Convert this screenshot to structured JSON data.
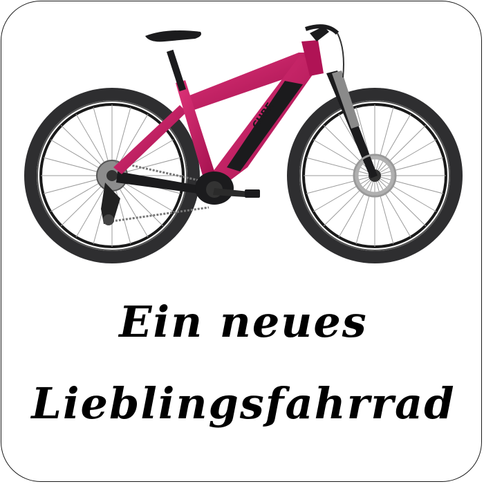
{
  "caption": {
    "line1": "Ein neues",
    "line2": "Lieblingsfahrrad"
  },
  "bike": {
    "brand": "CUBE",
    "frame_color": "#c4165f",
    "dark_color": "#1b1b1d",
    "tire_color": "#2e2e30"
  }
}
